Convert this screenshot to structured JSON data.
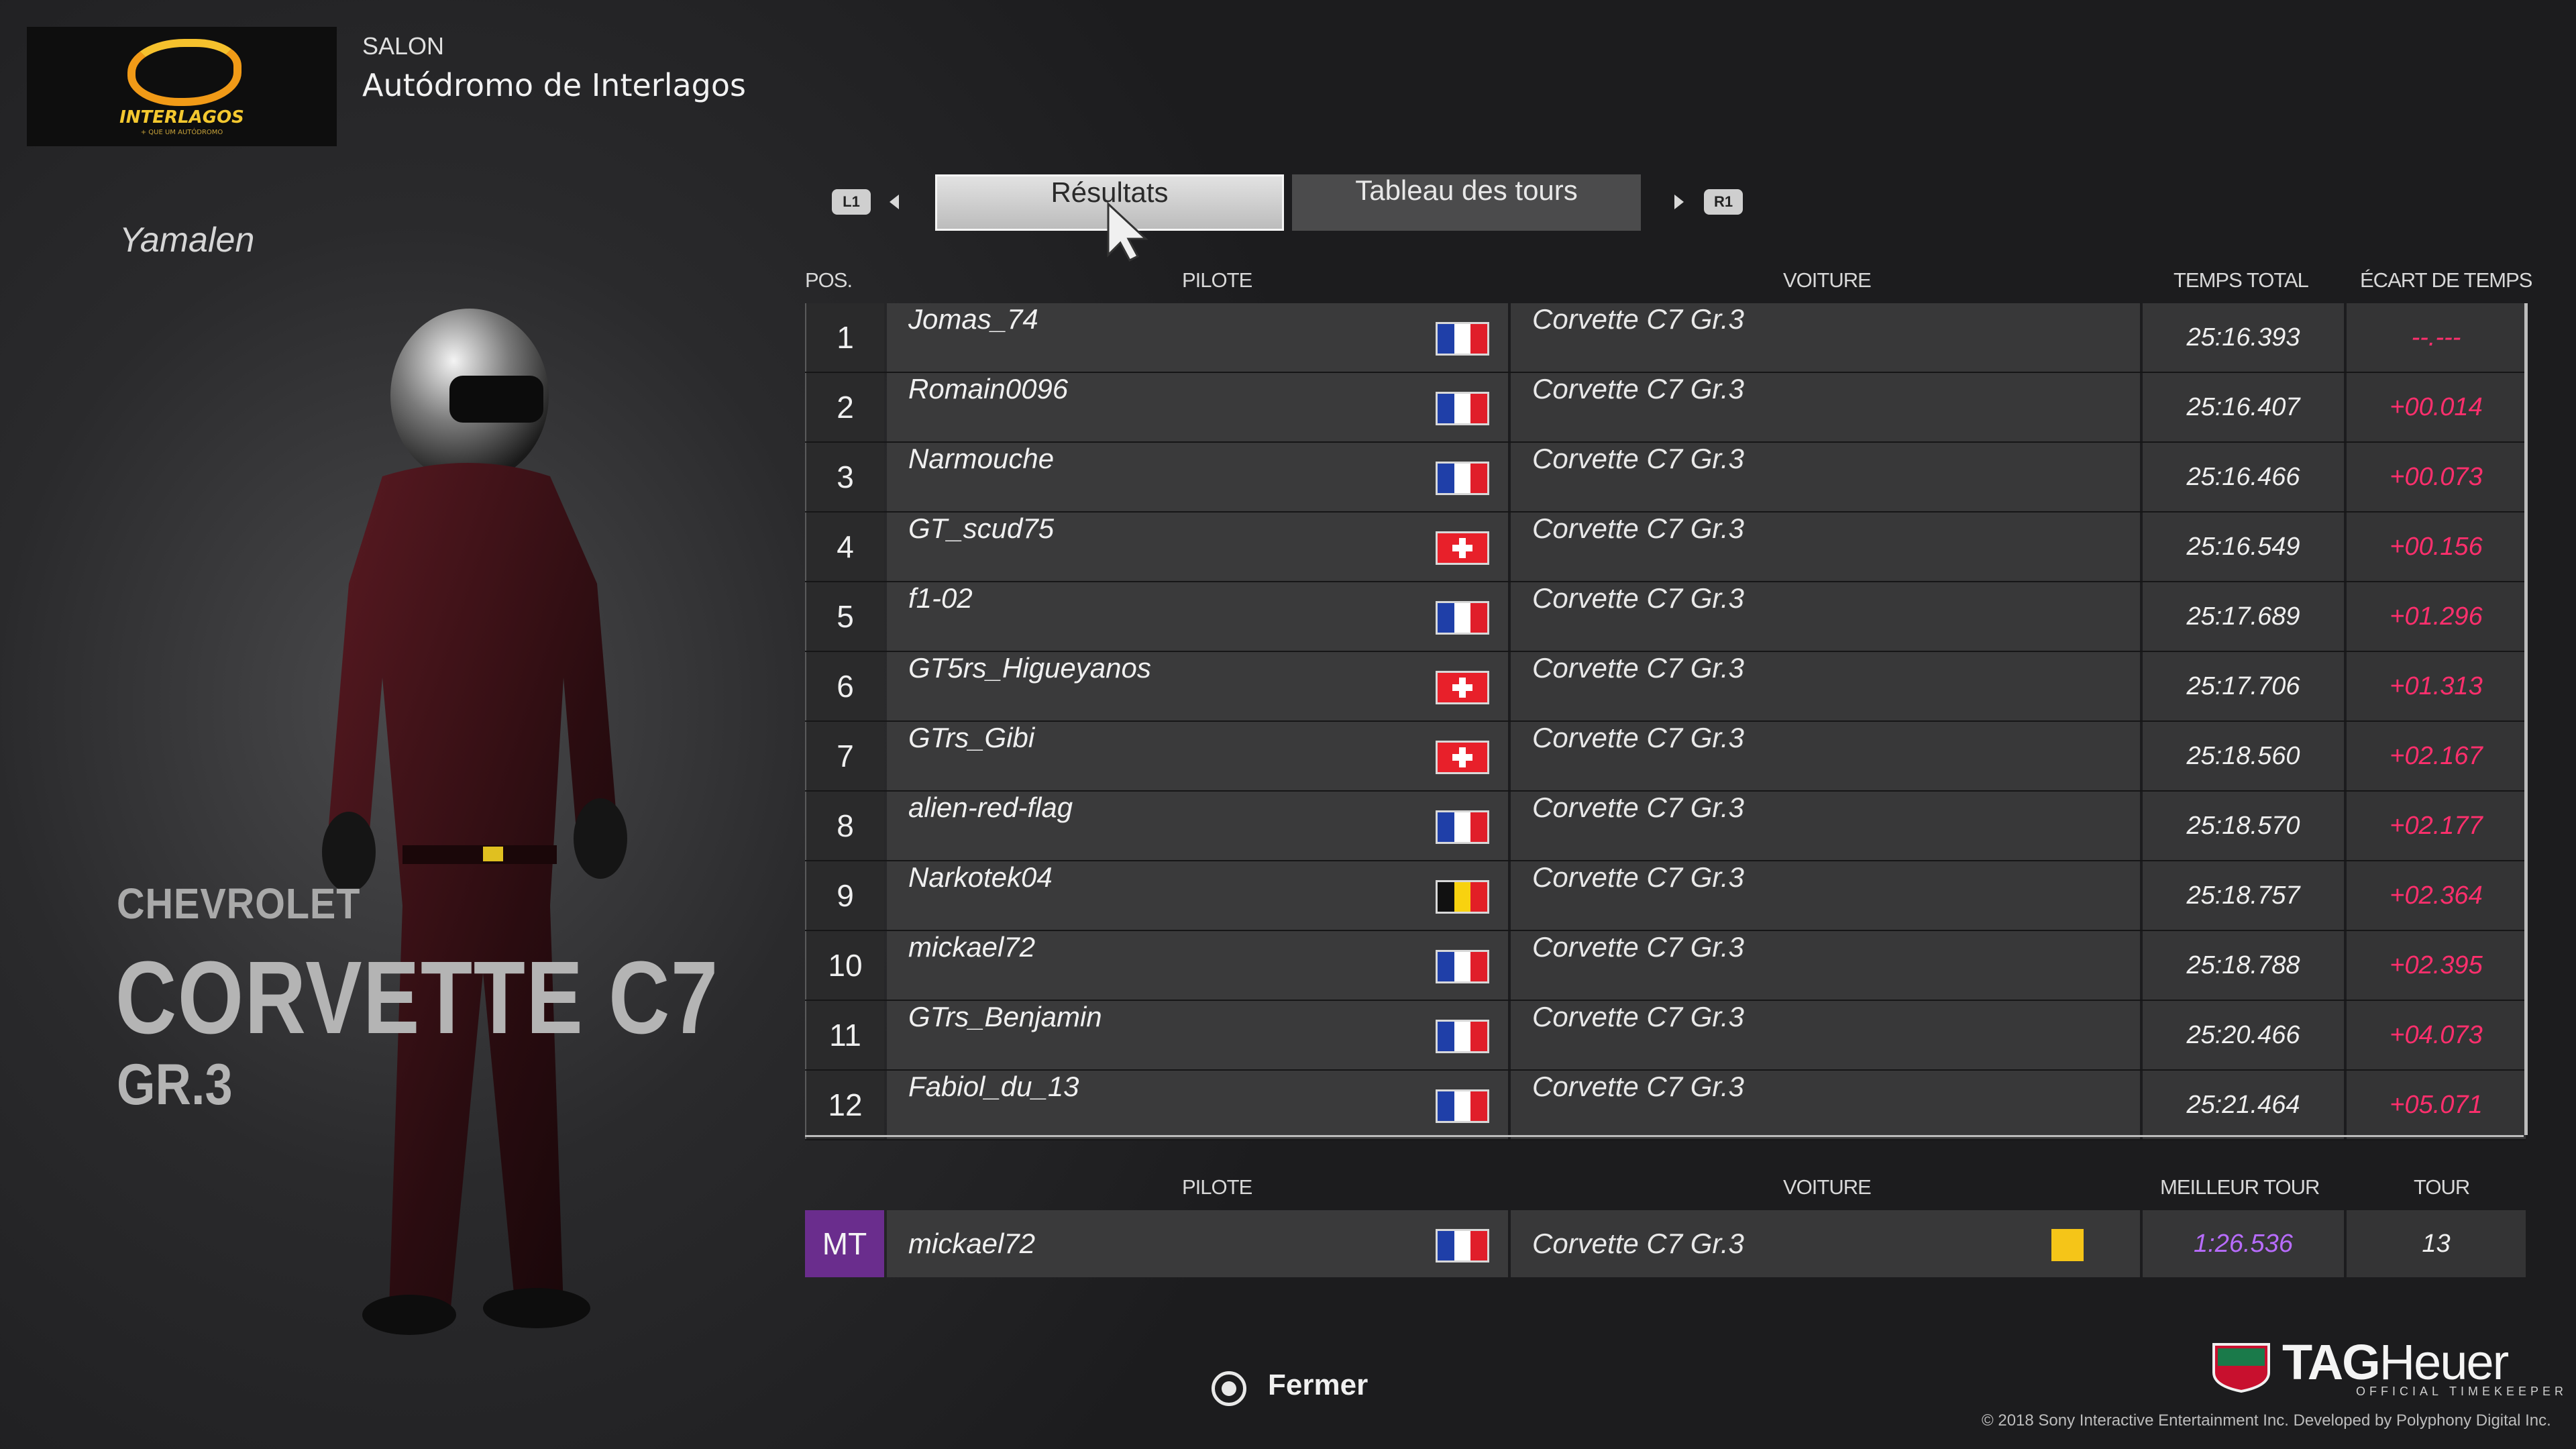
{
  "header": {
    "label": "SALON",
    "track": "Autódromo de Interlagos",
    "logo_text": "INTERLAGOS",
    "logo_subtext": "+ QUE UM AUTÓDROMO"
  },
  "player_name": "Yamalen",
  "car": {
    "make": "CHEVROLET",
    "model": "CORVETTE C7",
    "class": "GR.3"
  },
  "tabs": {
    "left_hint": "L1",
    "right_hint": "R1",
    "results": "Résultats",
    "laps": "Tableau des tours"
  },
  "results_table": {
    "headers": {
      "pos": "POS.",
      "driver": "PILOTE",
      "car": "VOITURE",
      "total_time": "TEMPS TOTAL",
      "gap": "ÉCART DE TEMPS"
    },
    "rows": [
      {
        "pos": "1",
        "driver": "Jomas_74",
        "flag": "fr",
        "car": "Corvette C7 Gr.3",
        "time": "25:16.393",
        "gap": "--.---"
      },
      {
        "pos": "2",
        "driver": "Romain0096",
        "flag": "fr",
        "car": "Corvette C7 Gr.3",
        "time": "25:16.407",
        "gap": "+00.014"
      },
      {
        "pos": "3",
        "driver": "Narmouche",
        "flag": "fr",
        "car": "Corvette C7 Gr.3",
        "time": "25:16.466",
        "gap": "+00.073"
      },
      {
        "pos": "4",
        "driver": "GT_scud75",
        "flag": "ch",
        "car": "Corvette C7 Gr.3",
        "time": "25:16.549",
        "gap": "+00.156"
      },
      {
        "pos": "5",
        "driver": "f1-02",
        "flag": "fr",
        "car": "Corvette C7 Gr.3",
        "time": "25:17.689",
        "gap": "+01.296"
      },
      {
        "pos": "6",
        "driver": "GT5rs_Higueyanos",
        "flag": "ch",
        "car": "Corvette C7 Gr.3",
        "time": "25:17.706",
        "gap": "+01.313"
      },
      {
        "pos": "7",
        "driver": "GTrs_Gibi",
        "flag": "ch",
        "car": "Corvette C7 Gr.3",
        "time": "25:18.560",
        "gap": "+02.167"
      },
      {
        "pos": "8",
        "driver": "alien-red-flag",
        "flag": "fr",
        "car": "Corvette C7 Gr.3",
        "time": "25:18.570",
        "gap": "+02.177"
      },
      {
        "pos": "9",
        "driver": "Narkotek04",
        "flag": "be",
        "car": "Corvette C7 Gr.3",
        "time": "25:18.757",
        "gap": "+02.364"
      },
      {
        "pos": "10",
        "driver": "mickael72",
        "flag": "fr",
        "car": "Corvette C7 Gr.3",
        "time": "25:18.788",
        "gap": "+02.395"
      },
      {
        "pos": "11",
        "driver": "GTrs_Benjamin",
        "flag": "fr",
        "car": "Corvette C7 Gr.3",
        "time": "25:20.466",
        "gap": "+04.073"
      },
      {
        "pos": "12",
        "driver": "Fabiol_du_13",
        "flag": "fr",
        "car": "Corvette C7 Gr.3",
        "time": "25:21.464",
        "gap": "+05.071"
      }
    ]
  },
  "best_lap": {
    "headers": {
      "driver": "PILOTE",
      "car": "VOITURE",
      "best": "MEILLEUR TOUR",
      "lap": "TOUR"
    },
    "badge": "MT",
    "driver": "mickael72",
    "flag": "fr",
    "car": "Corvette C7 Gr.3",
    "time": "1:26.536",
    "lap": "13",
    "swatch_color": "#f5c518"
  },
  "footer": {
    "close_label": "Fermer",
    "brand_tag": "TAG",
    "brand_heuer": "Heuer",
    "brand_sub": "OFFICIAL TIMEKEEPER",
    "copyright": "© 2018 Sony Interactive Entertainment Inc. Developed by Polyphony Digital Inc."
  },
  "colors": {
    "gap_red": "#ff2f6d",
    "best_purple": "#b86cff",
    "mt_badge": "#6a2d8d",
    "flag_fr": [
      "#1f3fa8",
      "#ffffff",
      "#e01e2a"
    ],
    "flag_be": [
      "#111111",
      "#f8d20f",
      "#e21f26"
    ],
    "flag_ch": "#e8202a"
  }
}
